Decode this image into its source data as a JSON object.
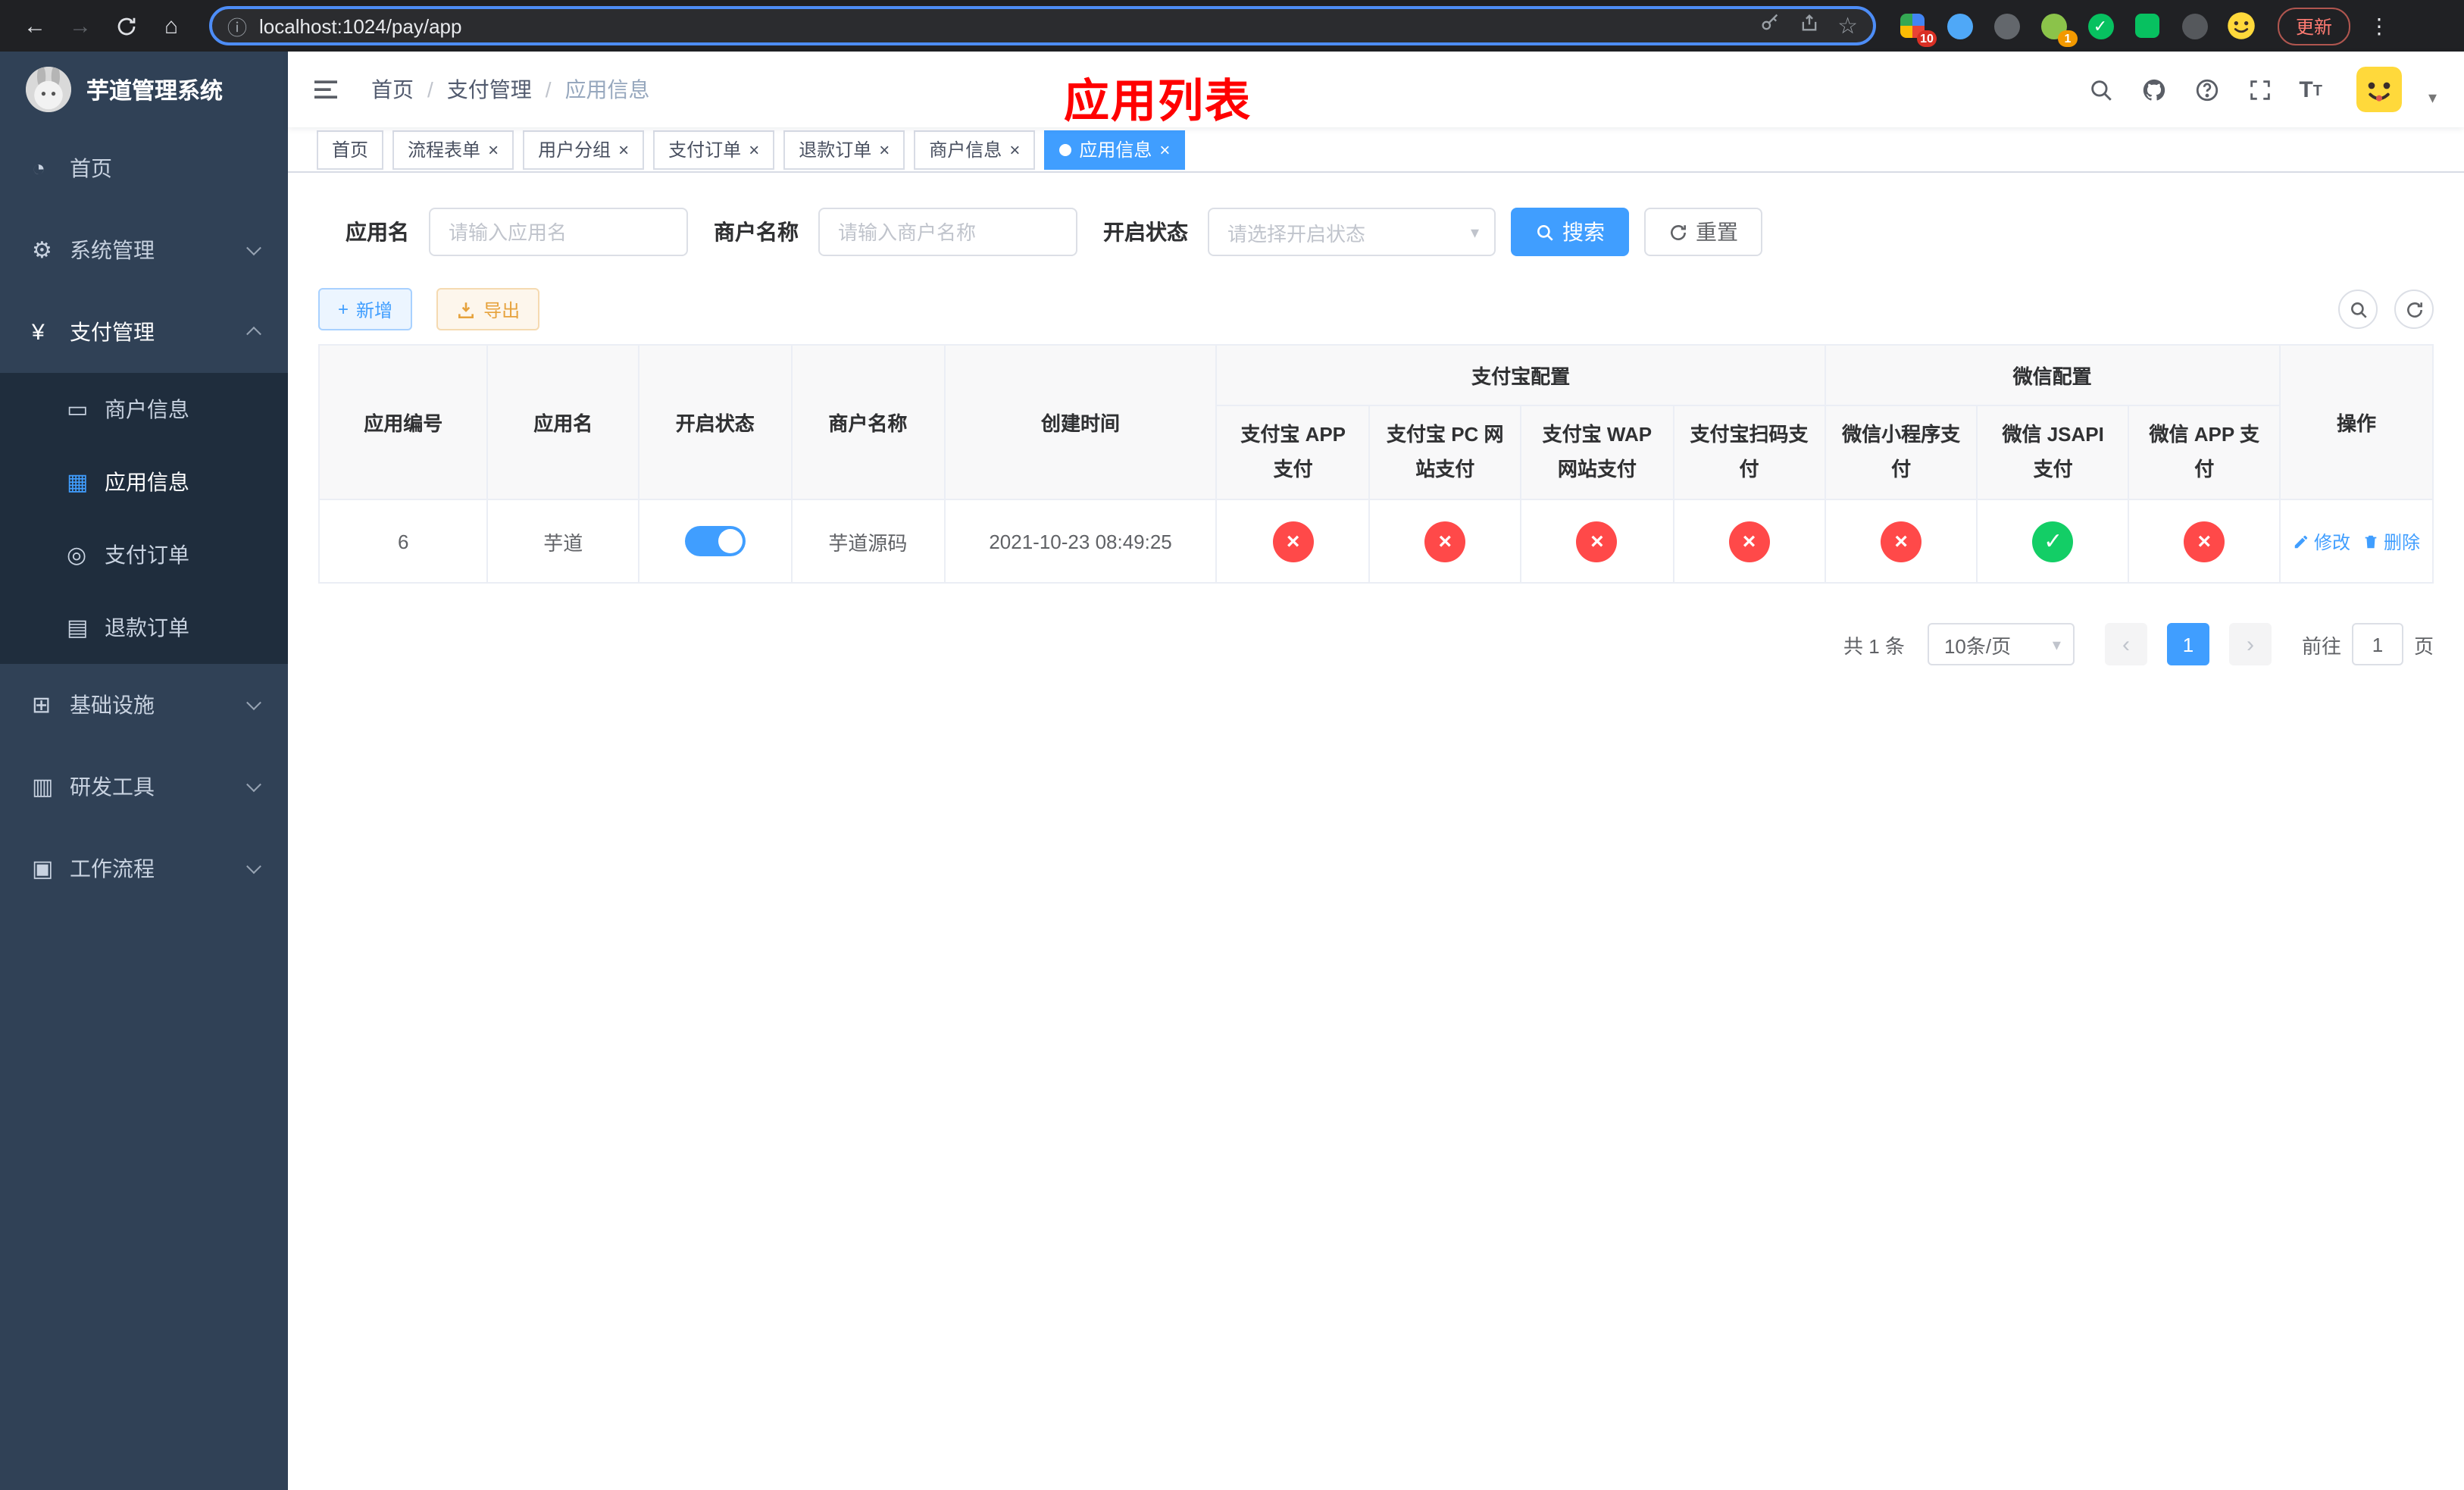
{
  "colors": {
    "accent": "#409eff",
    "success": "#13ce66",
    "danger": "#ff4949",
    "warning": "#e6a23c",
    "sidebar-bg": "#304156",
    "submenu-bg": "#1f2d3d",
    "annotation": "#ff0000"
  },
  "icons": {
    "back": "←",
    "forward": "→",
    "home": "⌂",
    "site_info": "ⓘ",
    "star": "☆",
    "menu_dots": "⋮",
    "dashboard": "◔",
    "gear": "⚙",
    "yen": "¥",
    "merchant": "▭",
    "app": "▦",
    "order": "◎",
    "refund": "▤",
    "infra": "⊞",
    "devtool": "▥",
    "workflow": "▣",
    "plus": "+",
    "close": "×",
    "caret": "▾",
    "check": "✓",
    "cross": "×",
    "prev": "‹",
    "next": "›",
    "slash": "/",
    "font_size": "T",
    "ext_check": "✓"
  },
  "browser": {
    "url": "localhost:1024/pay/app",
    "update_button": "更新",
    "ext_badge_main": "10",
    "ext_badge_profile": "1"
  },
  "sidebar": {
    "title": "芋道管理系统",
    "items": [
      {
        "label": "首页"
      },
      {
        "label": "系统管理"
      },
      {
        "label": "支付管理"
      },
      {
        "label": "商户信息"
      },
      {
        "label": "应用信息"
      },
      {
        "label": "支付订单"
      },
      {
        "label": "退款订单"
      },
      {
        "label": "基础设施"
      },
      {
        "label": "研发工具"
      },
      {
        "label": "工作流程"
      }
    ]
  },
  "header": {
    "breadcrumb": {
      "home": "首页",
      "section": "支付管理",
      "current": "应用信息"
    },
    "annotation": "应用列表"
  },
  "tabs": [
    {
      "label": "首页"
    },
    {
      "label": "流程表单"
    },
    {
      "label": "用户分组"
    },
    {
      "label": "支付订单"
    },
    {
      "label": "退款订单"
    },
    {
      "label": "商户信息"
    },
    {
      "label": "应用信息"
    }
  ],
  "filters": {
    "app_name_label": "应用名",
    "app_name_placeholder": "请输入应用名",
    "merchant_label": "商户名称",
    "merchant_placeholder": "请输入商户名称",
    "status_label": "开启状态",
    "status_placeholder": "请选择开启状态",
    "search_button": "搜索",
    "reset_button": "重置"
  },
  "toolbar": {
    "add_button": "新增",
    "export_button": "导出"
  },
  "table": {
    "group_headers": {
      "alipay": "支付宝配置",
      "wechat": "微信配置"
    },
    "columns": [
      "应用编号",
      "应用名",
      "开启状态",
      "商户名称",
      "创建时间",
      "支付宝 APP 支付",
      "支付宝 PC 网站支付",
      "支付宝 WAP 网站支付",
      "支付宝扫码支付",
      "微信小程序支付",
      "微信 JSAPI 支付",
      "微信 APP 支付",
      "操作"
    ],
    "rows": [
      {
        "id": "6",
        "name": "芋道",
        "enabled": true,
        "merchant": "芋道源码",
        "created": "2021-10-23 08:49:25",
        "statuses": [
          "fail",
          "fail",
          "fail",
          "fail",
          "fail",
          "success",
          "fail"
        ],
        "actions": {
          "edit": "修改",
          "delete": "删除"
        }
      }
    ]
  },
  "pagination": {
    "total": "共 1 条",
    "page_size": "10条/页",
    "page": "1",
    "goto_label": "前往",
    "goto_value": "1",
    "page_unit": "页"
  }
}
